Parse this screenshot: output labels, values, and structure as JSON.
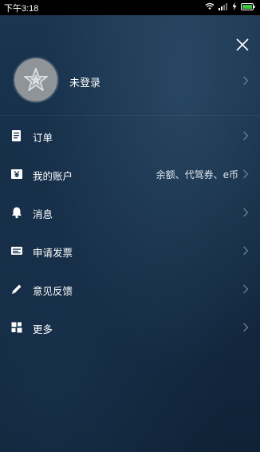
{
  "status_bar": {
    "time": "下午3:18"
  },
  "profile": {
    "name": "未登录"
  },
  "menu": [
    {
      "label": "订单",
      "sub": ""
    },
    {
      "label": "我的账户",
      "sub": "余额、代驾券、e币"
    },
    {
      "label": "消息",
      "sub": ""
    },
    {
      "label": "申请发票",
      "sub": ""
    },
    {
      "label": "意见反馈",
      "sub": ""
    },
    {
      "label": "更多",
      "sub": ""
    }
  ]
}
